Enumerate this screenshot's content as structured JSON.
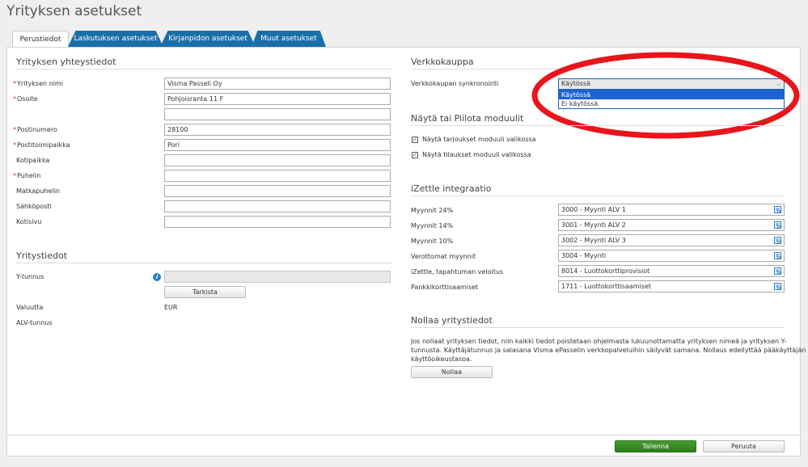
{
  "page": {
    "title": "Yrityksen asetukset"
  },
  "tabs": [
    {
      "label": "Perustiedot"
    },
    {
      "label": "Laskutuksen asetukset"
    },
    {
      "label": "Kirjanpidon asetukset"
    },
    {
      "label": "Muut asetukset"
    }
  ],
  "contact": {
    "title": "Yrityksen yhteystiedot",
    "required_marker": "*",
    "fields": {
      "company_name": {
        "label": "Yrityksen nimi",
        "value": "Visma Passeli Oy"
      },
      "address": {
        "label": "Osoite",
        "value": "Pohjoisranta 11 F"
      },
      "address2": {
        "value": ""
      },
      "postal_code": {
        "label": "Postinumero",
        "value": "28100"
      },
      "post_office": {
        "label": "Postitoimipaikka",
        "value": "Pori"
      },
      "domicile": {
        "label": "Kotipaikka",
        "value": ""
      },
      "phone": {
        "label": "Puhelin",
        "value": ""
      },
      "mobile": {
        "label": "Matkapuhelin",
        "value": ""
      },
      "email": {
        "label": "Sähköposti",
        "value": ""
      },
      "homepage": {
        "label": "Kotisivu",
        "value": ""
      }
    }
  },
  "company_info": {
    "title": "Yritystiedot",
    "business_id_label": "Y-tunnus",
    "check_button": "Tarkista",
    "currency_label": "Valuutta",
    "currency_value": "EUR",
    "vat_id_label": "ALV-tunnus"
  },
  "webshop": {
    "title": "Verkkokauppa",
    "sync_label": "Verkkokaupan synkronointi",
    "selected": "Käytössä",
    "options": [
      "Käytössä",
      "Ei käytössä"
    ]
  },
  "modules": {
    "title": "Näytä tai Piilota moduulit",
    "items": [
      {
        "label": "Näytä tarjoukset moduuli valikossa",
        "checked": true
      },
      {
        "label": "Näytä tilaukset moduuli valikossa",
        "checked": true
      }
    ]
  },
  "izettle": {
    "title": "iZettle integraatio",
    "rows": [
      {
        "label": "Myynnit 24%",
        "value": "3000 - Myynti ALV 1"
      },
      {
        "label": "Myynnit 14%",
        "value": "3001 - Myynti ALV 2"
      },
      {
        "label": "Myynnit 10%",
        "value": "3002 - Myynti ALV 3"
      },
      {
        "label": "Verottomat myynnit",
        "value": "3004 - Myynti"
      },
      {
        "label": "iZettle, tapahtuman veloitus",
        "value": "8014 - Luottokorttiprovisiot"
      },
      {
        "label": "Pankkikorttisaamiset",
        "value": "1711 - Luottokorttisaamiset"
      }
    ]
  },
  "reset": {
    "title": "Nollaa yritystiedot",
    "description_line1": "Jos nollaat yrityksen tiedot, niin kaikki tiedot poistetaan ohjelmasta lukuunottamatta yrityksen nimeä ja yrityksen Y-",
    "description_line2": "tunnusta. Käyttäjätunnus ja salasana Visma ePasselin verkkopalveluihin säilyvät samana. Nollaus edellyttää pääkäyttäjän",
    "description_line3": "käyttöoikeustasoa.",
    "button": "Nollaa"
  },
  "footer": {
    "save": "Tallenna",
    "cancel": "Peruuta"
  },
  "colors": {
    "tab_blue": "#1a6fa8",
    "save_green": "#3a8c26",
    "annotation_red": "#e8151b"
  }
}
